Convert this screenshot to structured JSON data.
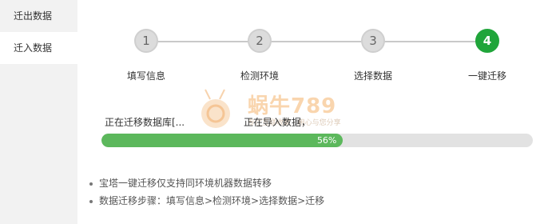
{
  "sidebar": {
    "items": [
      {
        "label": "迁出数据",
        "active": false
      },
      {
        "label": "迁入数据",
        "active": true
      }
    ]
  },
  "steps": [
    {
      "number": "1",
      "label": "填写信息",
      "done": false
    },
    {
      "number": "2",
      "label": "检测环境",
      "done": false
    },
    {
      "number": "3",
      "label": "选择数据",
      "done": false
    },
    {
      "number": "4",
      "label": "一键迁移",
      "done": true
    }
  ],
  "status": {
    "main": "正在迁移数据库[...",
    "sub": "正在导入数据，"
  },
  "progress": {
    "value": 56,
    "label": "56%"
  },
  "tips": [
    "宝塔一键迁移仅支持同环境机器数据转移",
    "数据迁移步骤：填写信息>检测环境>选择数据>迁移"
  ],
  "watermark": {
    "text": "蜗牛789",
    "sub": "专注互联收藏 · 用心与您分享"
  },
  "colors": {
    "accent": "#20a53a",
    "progress": "#5cb85c",
    "sidebar_bg": "#f2f2f2"
  }
}
